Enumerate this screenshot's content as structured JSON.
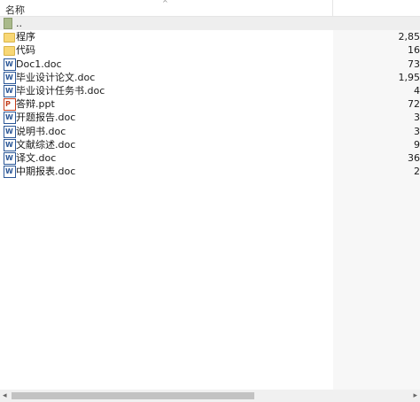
{
  "header": {
    "name_label": "名称",
    "sort_arrow": "^"
  },
  "rows": [
    {
      "name": "..",
      "size": "",
      "icon": "folder-up"
    },
    {
      "name": "程序",
      "size": "2,85",
      "icon": "folder"
    },
    {
      "name": "代码",
      "size": "16",
      "icon": "folder"
    },
    {
      "name": "Doc1.doc",
      "size": "73",
      "icon": "word-doc"
    },
    {
      "name": "毕业设计论文.doc",
      "size": "1,95",
      "icon": "word-doc"
    },
    {
      "name": "毕业设计任务书.doc",
      "size": "4",
      "icon": "word-doc"
    },
    {
      "name": "答辩.ppt",
      "size": "72",
      "icon": "powerpoint"
    },
    {
      "name": "开题报告.doc",
      "size": "3",
      "icon": "word-doc"
    },
    {
      "name": "说明书.doc",
      "size": "3",
      "icon": "word-doc"
    },
    {
      "name": "文献综述.doc",
      "size": "9",
      "icon": "word-doc"
    },
    {
      "name": "译文.doc",
      "size": "36",
      "icon": "word-doc"
    },
    {
      "name": "中期报表.doc",
      "size": "2",
      "icon": "word-doc"
    }
  ],
  "scrollbar": {
    "left_arrow": "◂",
    "right_arrow": "▸"
  }
}
